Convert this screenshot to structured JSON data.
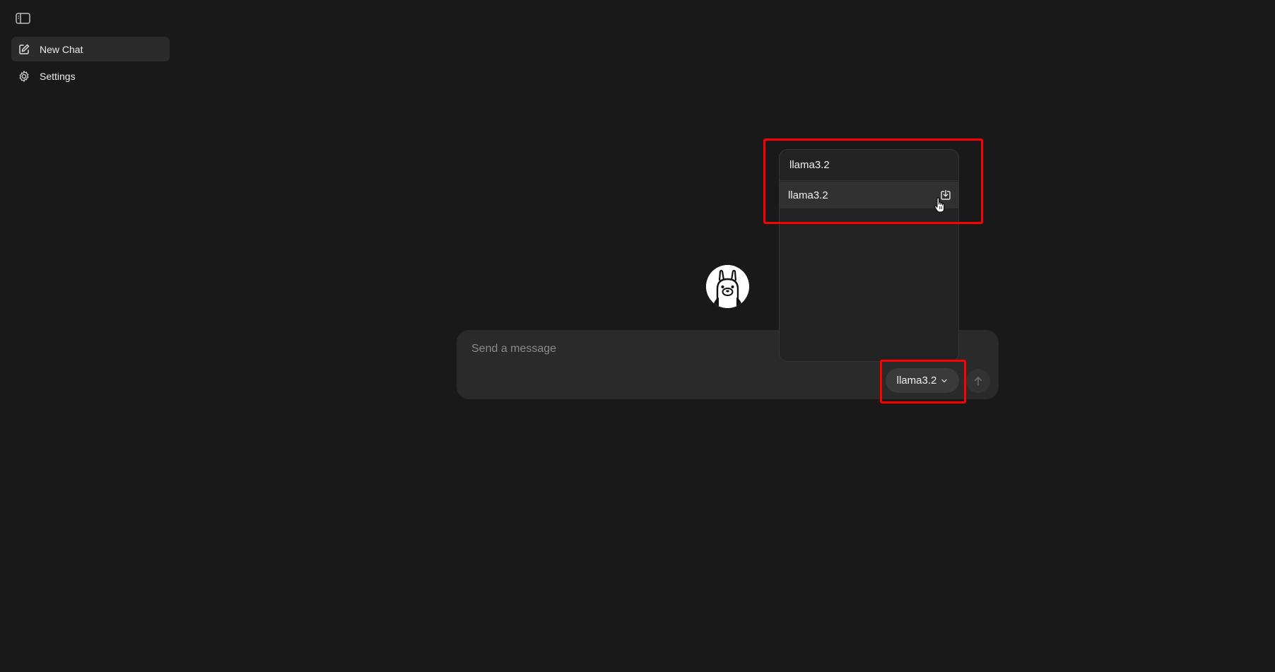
{
  "sidebar": {
    "toggle_icon": "sidebar-toggle-icon",
    "items": [
      {
        "label": "New Chat",
        "icon": "compose-icon",
        "active": true
      },
      {
        "label": "Settings",
        "icon": "gear-icon",
        "active": false
      }
    ]
  },
  "logo": {
    "icon": "llama-logo-icon"
  },
  "composer": {
    "placeholder": "Send a message",
    "model_selector": {
      "label": "llama3.2",
      "icon": "chevron-down-icon"
    },
    "send_icon": "arrow-up-icon"
  },
  "model_dropdown": {
    "search_value": "llama3.2",
    "items": [
      {
        "label": "llama3.2",
        "action_icon": "download-icon"
      }
    ]
  },
  "colors": {
    "background": "#191919",
    "sidebar_active": "#2b2b2b",
    "composer": "#2a2a2a",
    "dropdown": "#232323",
    "dropdown_item_hover": "#313131",
    "highlight": "#ff0000"
  }
}
